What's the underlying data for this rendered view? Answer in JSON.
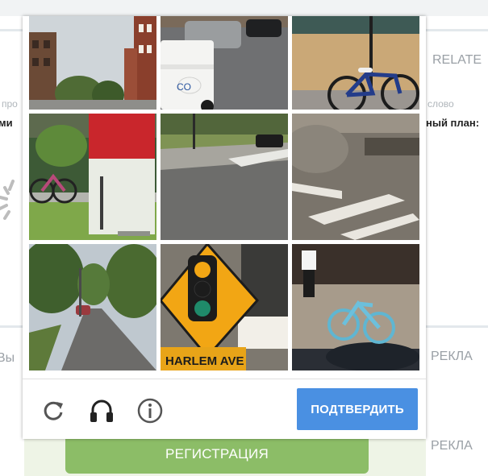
{
  "background": {
    "right_label_1": "RELATE",
    "right_label_2": "РЕКЛА",
    "right_label_3": "РЕКЛА",
    "left_label_1": "ми",
    "left_label_2": "Вы",
    "left_small_1": "про",
    "right_small_1": "слово",
    "right_dark_1": "ный план:"
  },
  "captcha": {
    "tiles": [
      {
        "id": "1",
        "desc": "street-buildings"
      },
      {
        "id": "2",
        "desc": "van-cars"
      },
      {
        "id": "3",
        "desc": "bicycle-wall"
      },
      {
        "id": "4",
        "desc": "bike-pole"
      },
      {
        "id": "5",
        "desc": "intersection"
      },
      {
        "id": "6",
        "desc": "crosswalk"
      },
      {
        "id": "7",
        "desc": "tree-street"
      },
      {
        "id": "8",
        "desc": "traffic-sign"
      },
      {
        "id": "9",
        "desc": "blue-bicycle"
      }
    ],
    "sign_text": "HARLEM AVE",
    "van_text": "CO",
    "verify_label": "ПОДТВЕРДИТЬ"
  },
  "registration": {
    "label": "РЕГИСТРАЦИЯ"
  },
  "colors": {
    "verify": "#4a90e2",
    "register": "#8cbd67"
  }
}
